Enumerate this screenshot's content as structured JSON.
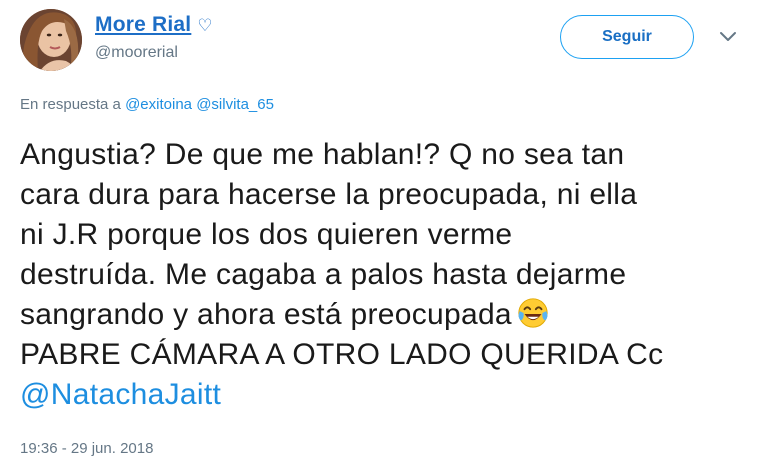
{
  "user": {
    "display_name": "More Rial",
    "verified_symbol": "♡",
    "handle": "@moorerial"
  },
  "actions": {
    "follow_label": "Seguir",
    "more_icon": "chevron-down-icon"
  },
  "reply": {
    "prefix": "En respuesta a",
    "mentions": [
      "@exitoina",
      "@silvita_65"
    ]
  },
  "tweet": {
    "lines": [
      "Angustia? De que me hablan!? Q no sea tan",
      "cara dura para hacerse la preocupada, ni ella",
      "ni J.R porque los dos quieren verme",
      "destruída. Me cagaba a palos hasta dejarme",
      "sangrando y ahora está preocupada",
      "PABRE CÁMARA A OTRO LADO QUERIDA Cc",
      "@NatachaJaitt"
    ],
    "emoji": "face-with-tears-of-joy"
  },
  "timestamp": "19:36 - 29 jun. 2018",
  "colors": {
    "link": "#1d8ee0",
    "name": "#1d6ec6",
    "muted": "#657786",
    "button_border": "#1da1f2"
  }
}
